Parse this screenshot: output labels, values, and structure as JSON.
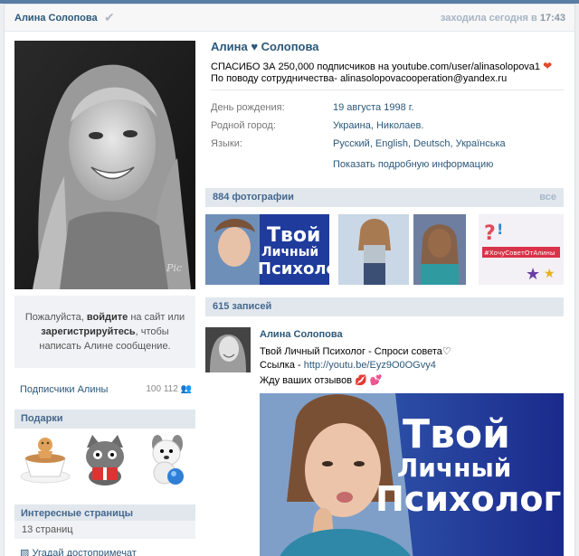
{
  "header": {
    "name": "Алина Солопова",
    "online_prefix": "заходила сегодня в",
    "online_time": "17:43"
  },
  "profile": {
    "name": "Алина ♥ Солопова",
    "status_line1_text": "СПАСИБО ЗА 250,000 подписчиков на youtube.com/user/alinasolopova1",
    "status_line2_text": "По поводу сотрудничества- alinasolopovacooperation@yandex.ru",
    "info": [
      {
        "label": "День рождения:",
        "value": "19 августа 1998 г."
      },
      {
        "label": "Родной город:",
        "value": "Украина, Николаев."
      },
      {
        "label": "Языки:",
        "value": "Русский, English, Deutsch, Українська"
      }
    ],
    "more_info": "Показать подробную информацию"
  },
  "photos": {
    "title": "884 фотографии",
    "all": "все",
    "thumb1_text": [
      "Твой",
      "Личный",
      "Психоло"
    ],
    "thumb4_text": "#ХочуСоветОтАлины"
  },
  "login": {
    "please": "Пожалуйста,",
    "login_link": "войдите",
    "middle": "на сайт или",
    "register_link": "зарегистрируйтесь",
    "end": ", чтобы написать Алине сообщение."
  },
  "subscribers": {
    "label": "Подписчики Алины",
    "count": "100 112"
  },
  "gifts": {
    "title": "Подарки"
  },
  "pages": {
    "title": "Интересные страницы",
    "count": "13 страниц",
    "first": "Угадай достопримечат"
  },
  "wall": {
    "title": "615 записей",
    "author": "Алина Солопова",
    "line1": "Твой Личный Психолог - Спроси совета♡",
    "line2_prefix": "Ссылка - ",
    "line2_link": "http://youtu.be/Eyz9O0OGvy4",
    "line3": "Жду ваших отзывов",
    "image_text": [
      "Твой",
      "Личный",
      "Психолог"
    ]
  },
  "colors": {
    "accent": "#2b587a",
    "head": "#e1e7ed",
    "heart": "#e3492a"
  }
}
